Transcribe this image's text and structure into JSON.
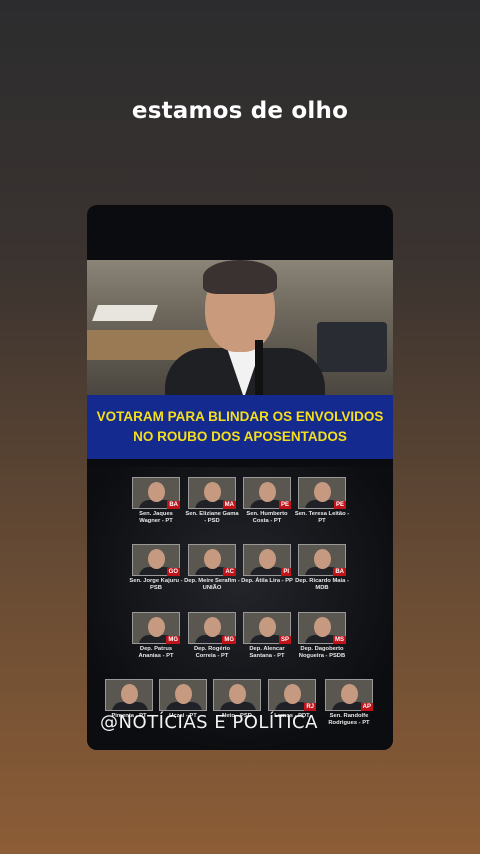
{
  "caption": "estamos de olho",
  "banner": {
    "line1": "VOTARAM PARA BLINDAR OS ENVOLVIDOS",
    "line2": "NO ROUBO  DOS APOSENTADOS"
  },
  "people": [
    {
      "name": "Sen. Jaques Wagner - PT",
      "state": "BA"
    },
    {
      "name": "Sen. Eliziane Gama - PSD",
      "state": "MA"
    },
    {
      "name": "Sen. Humberto Costa - PT",
      "state": "PE"
    },
    {
      "name": "Sen. Teresa Leitão - PT",
      "state": "PE"
    },
    {
      "name": "Sen. Jorge Kajuru - PSB",
      "state": "GO"
    },
    {
      "name": "Dep. Meire Serafim - UNIÃO",
      "state": "AC"
    },
    {
      "name": "Dep. Átila Lira - PP",
      "state": "PI"
    },
    {
      "name": "Dep. Ricardo Maia - MDB",
      "state": "BA"
    },
    {
      "name": "Dep. Patrus Ananias - PT",
      "state": "MG"
    },
    {
      "name": "Dep. Rogério Correia - PT",
      "state": "MG"
    },
    {
      "name": "Dep. Alencar Santana - PT",
      "state": "SP"
    },
    {
      "name": "Dep. Dagoberto Nogueira - PSDB",
      "state": "MS"
    },
    {
      "name": "Pimenta - PT",
      "state": ""
    },
    {
      "name": "Uczai - PT",
      "state": ""
    },
    {
      "name": "Neto - PSD",
      "state": ""
    },
    {
      "name": "Lemos - PDT",
      "state": "RJ"
    },
    {
      "name": "Sen. Randolfe Rodrigues - PT",
      "state": "AP"
    }
  ],
  "watermark": "@NOTÍCIAS E POLÍTICA"
}
